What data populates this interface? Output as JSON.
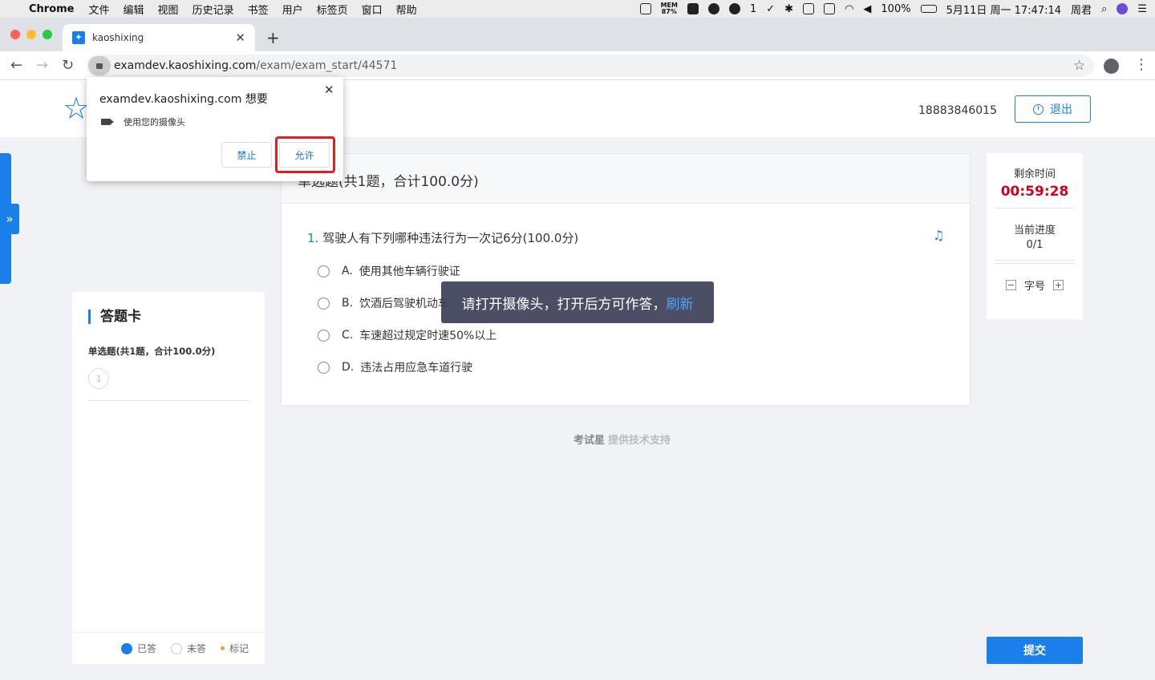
{
  "menubar": {
    "app": "Chrome",
    "items": [
      "文件",
      "编辑",
      "视图",
      "历史记录",
      "书签",
      "用户",
      "标签页",
      "窗口",
      "帮助"
    ],
    "mem_label": "MEM",
    "mem_value": "87%",
    "wechat_count": "1",
    "battery": "100%",
    "datetime": "5月11日 周一 17:47:14",
    "user": "周君"
  },
  "browser": {
    "tab_title": "kaoshixing",
    "url_host": "examdev.kaoshixing.com",
    "url_path": "/exam/exam_start/44571"
  },
  "header": {
    "phone": "18883846015",
    "logout_label": "退出"
  },
  "answer_card": {
    "title": "答题卡",
    "section": "单选题(共1题，合计100.0分)",
    "numbers": [
      "1"
    ],
    "legend": {
      "answered": "已答",
      "unanswered": "未答",
      "marked": "标记"
    }
  },
  "question": {
    "section_title": "单选题(共1题，合计100.0分)",
    "number": "1.",
    "text": "驾驶人有下列哪种违法行为一次记6分(100.0分)",
    "options": [
      {
        "letter": "A.",
        "text": "使用其他车辆行驶证"
      },
      {
        "letter": "B.",
        "text": "饮酒后驾驶机动车"
      },
      {
        "letter": "C.",
        "text": "车速超过规定时速50%以上"
      },
      {
        "letter": "D.",
        "text": "违法占用应急车道行驶"
      }
    ]
  },
  "toast": {
    "text": "请打开摄像头，打开后方可作答，",
    "link": "刷新"
  },
  "footer": {
    "brand": "考试星",
    "text": "提供技术支持"
  },
  "status": {
    "time_label": "剩余时间",
    "time_value": "00:59:28",
    "progress_label": "当前进度",
    "progress_value": "0/1",
    "font_label": "字号",
    "minus": "−",
    "plus": "+"
  },
  "submit_label": "提交",
  "permission": {
    "title": "examdev.kaoshixing.com 想要",
    "request": "使用您的摄像头",
    "deny_label": "禁止",
    "allow_label": "允许",
    "close": "✕"
  },
  "colors": {
    "accent": "#1a7fe8",
    "timer": "#d0021b",
    "highlight": "#e02020"
  }
}
